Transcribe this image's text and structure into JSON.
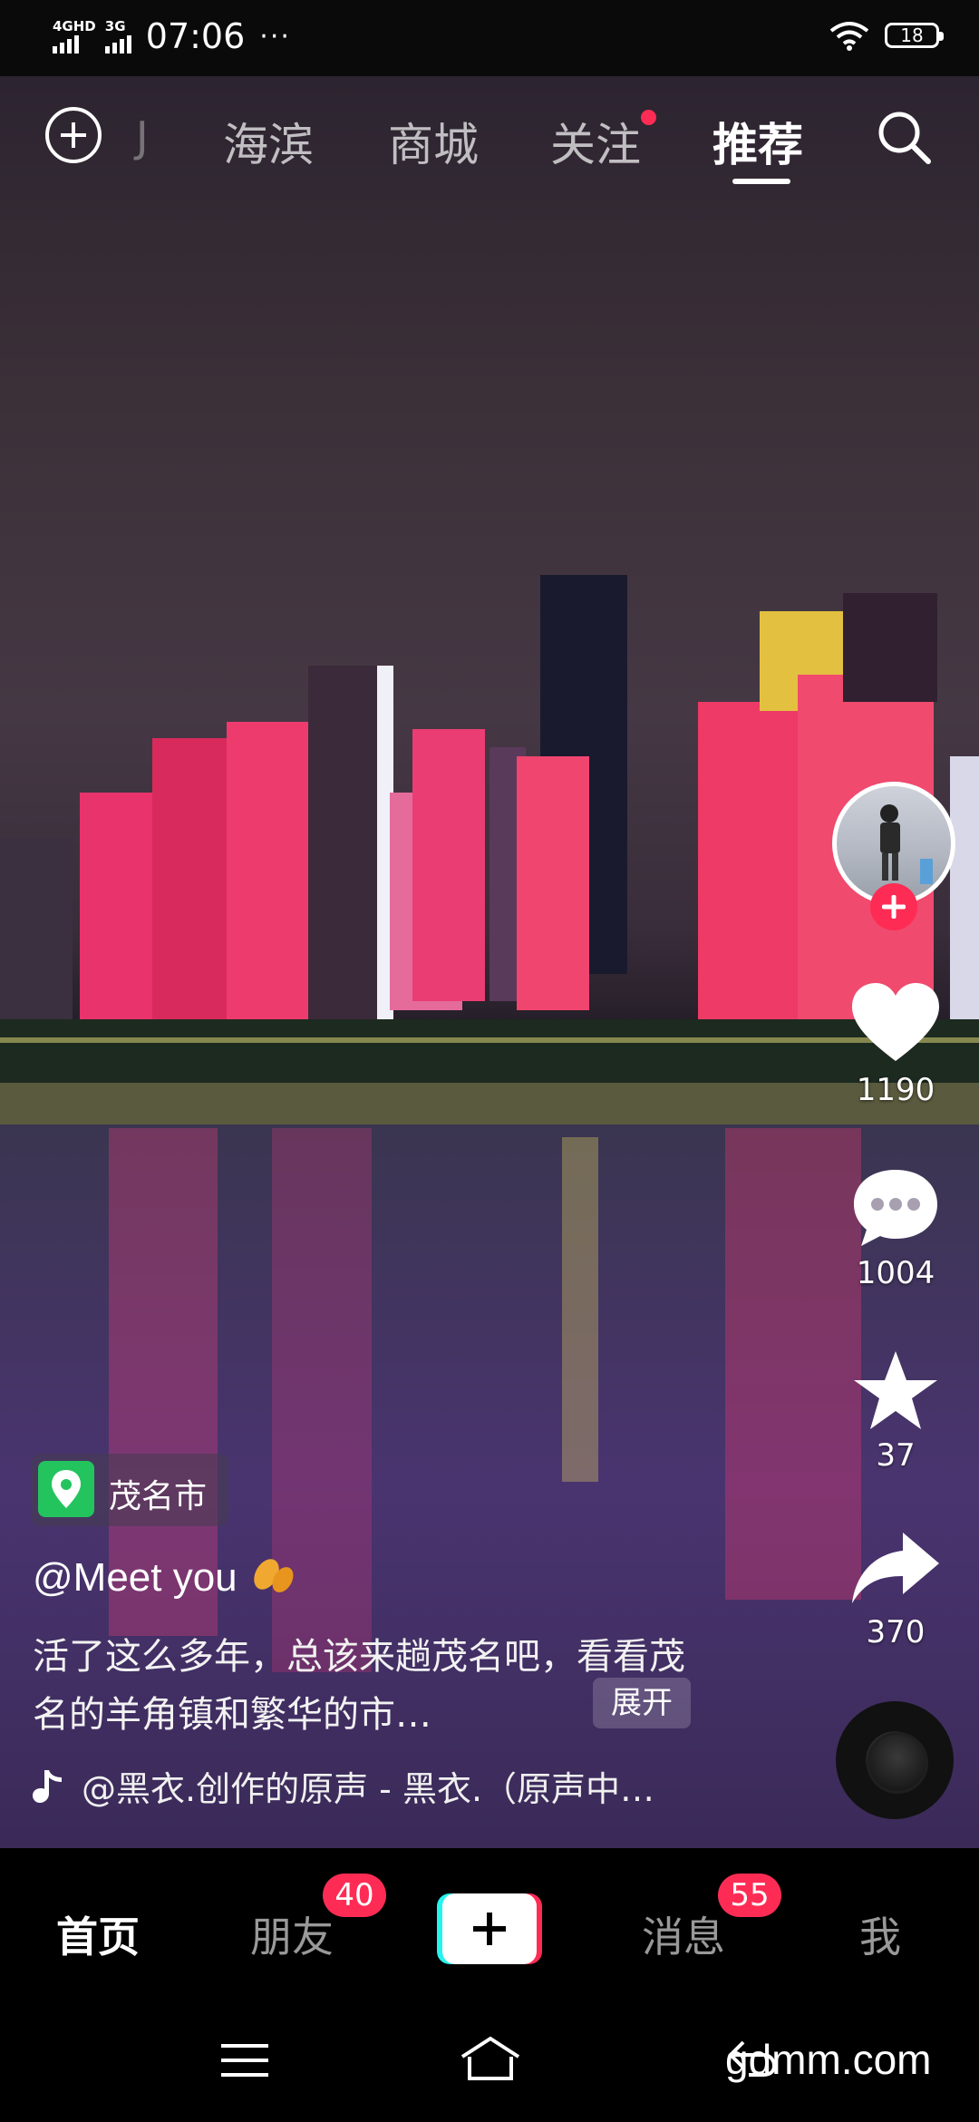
{
  "status_bar": {
    "signal1_label": "4GHD",
    "signal2_label": "3G",
    "time": "07:06",
    "dots": "···",
    "battery": "18"
  },
  "top_nav": {
    "partial_tab": "J",
    "tabs": [
      "海滨",
      "商城",
      "关注",
      "推荐"
    ],
    "active_tab": "推荐"
  },
  "video": {
    "location": "茂名市",
    "author": "@Meet you",
    "caption": "活了这么多年，总该来趟茂名吧，看看茂名的羊角镇和繁华的市…",
    "expand_label": "展开",
    "music": "@黑衣.创作的原声 - 黑衣.（原声中…"
  },
  "rail": {
    "likes": "1190",
    "comments": "1004",
    "favorites": "37",
    "shares": "370"
  },
  "bottom_nav": {
    "home": "首页",
    "friends": "朋友",
    "friends_badge": "40",
    "messages": "消息",
    "messages_badge": "55",
    "me": "我"
  },
  "watermark": "gdmm.com",
  "colors": {
    "accent": "#fe2c55",
    "cyan": "#25f4ee",
    "location_green": "#23c45e"
  }
}
